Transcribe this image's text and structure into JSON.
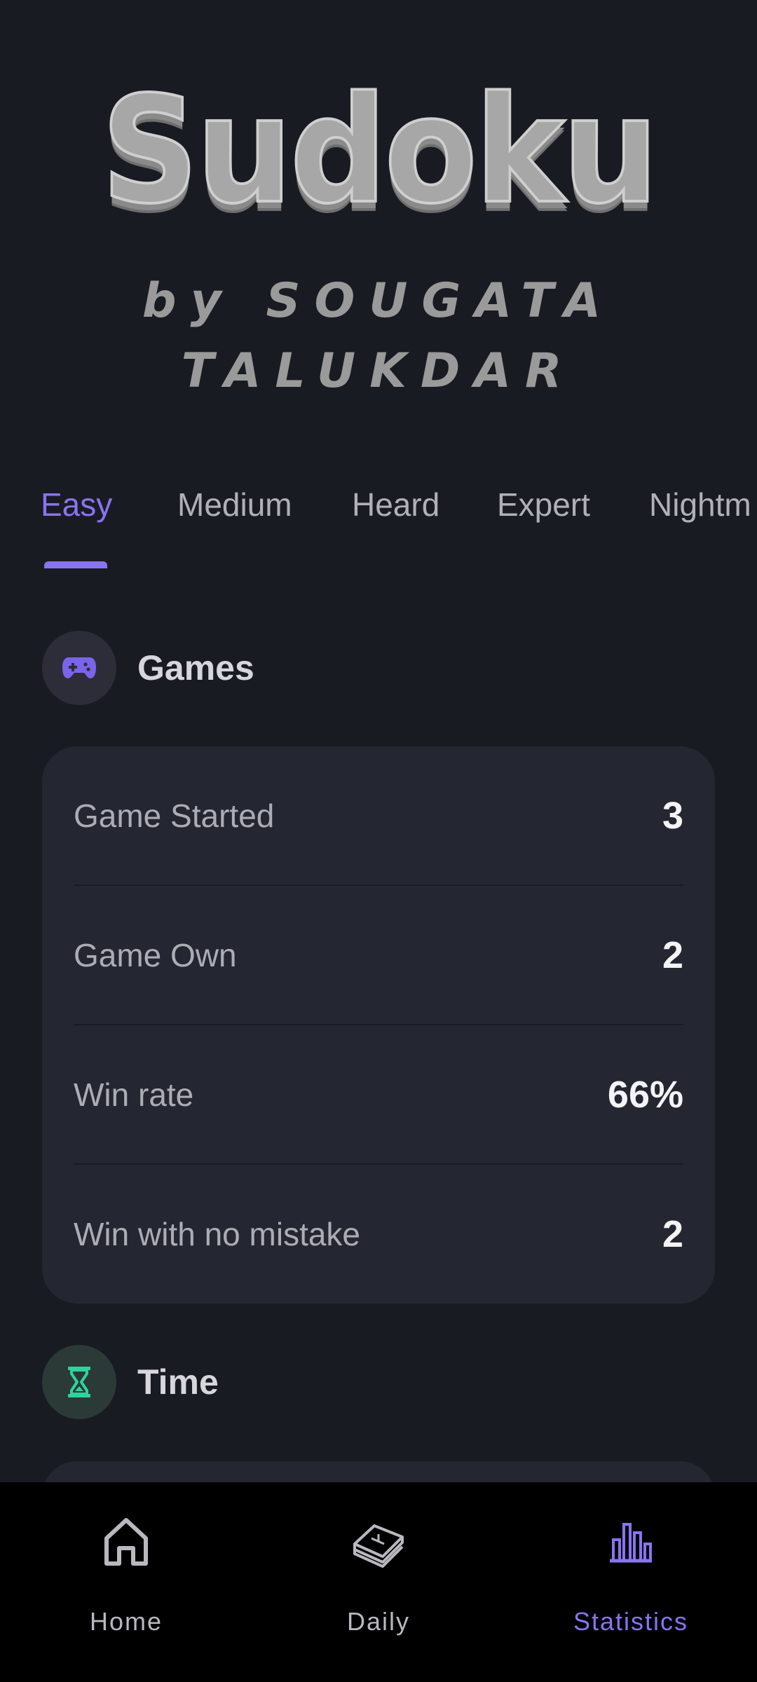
{
  "header": {
    "title": "Sudoku",
    "byline": "by SOUGATA TALUKDAR"
  },
  "tabs": {
    "items": [
      "Easy",
      "Medium",
      "Heard",
      "Expert",
      "Nightm"
    ],
    "active_index": 0
  },
  "games_section": {
    "title": "Games",
    "icon": "gamepad-icon",
    "rows": [
      {
        "label": "Game Started",
        "value": "3"
      },
      {
        "label": "Game Own",
        "value": "2"
      },
      {
        "label": "Win rate",
        "value": "66%"
      },
      {
        "label": "Win with no mistake",
        "value": "2"
      }
    ]
  },
  "time_section": {
    "title": "Time",
    "icon": "hourglass-icon"
  },
  "bottom_nav": {
    "items": [
      {
        "label": "Home",
        "icon": "home-icon"
      },
      {
        "label": "Daily",
        "icon": "daily-book-icon"
      },
      {
        "label": "Statistics",
        "icon": "bar-chart-icon"
      }
    ],
    "active_index": 2
  },
  "colors": {
    "background": "#191b22",
    "card": "#242632",
    "accent": "#8a73f2",
    "time_accent": "#2ed39b",
    "nav_background": "#000000"
  }
}
